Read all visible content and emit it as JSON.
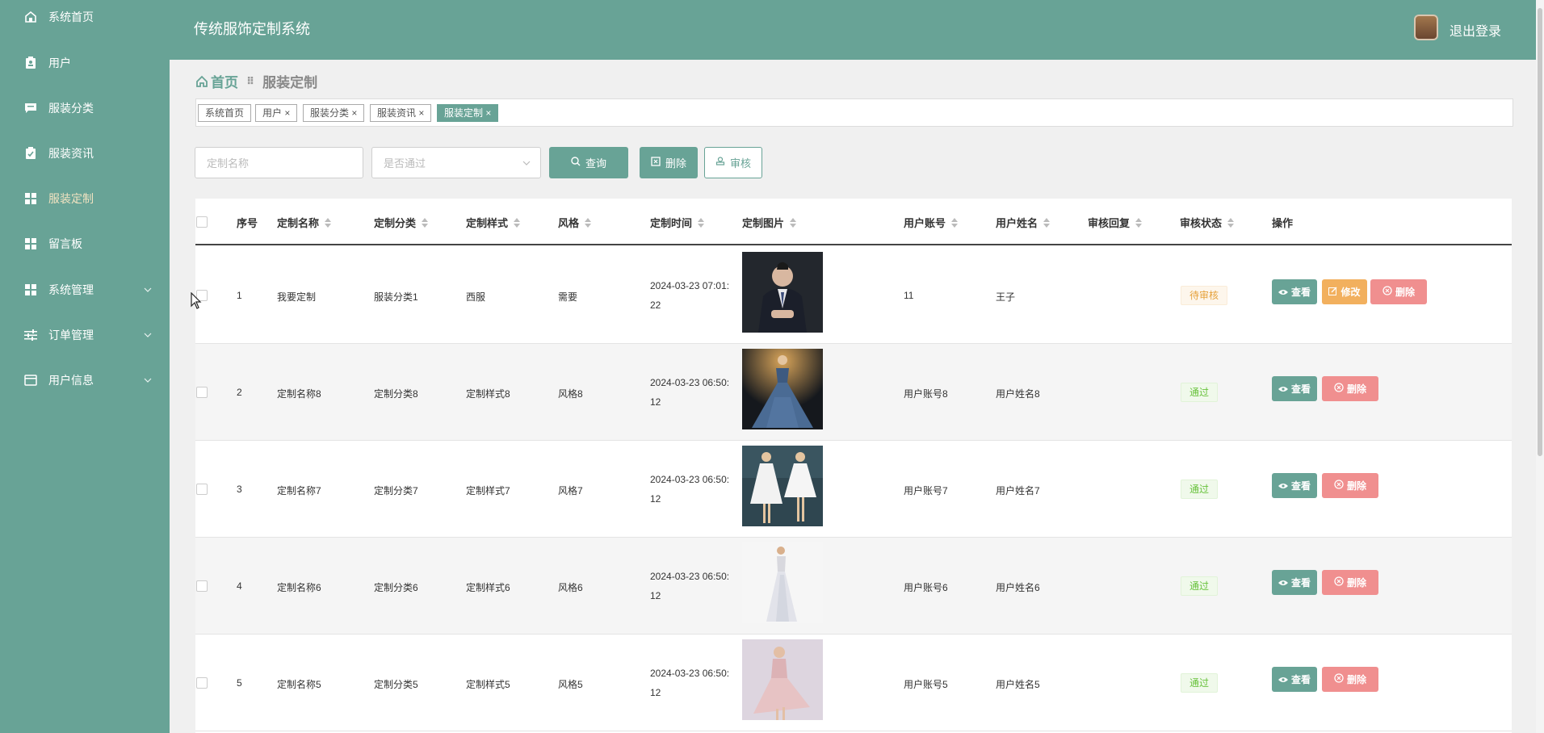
{
  "sidebar": {
    "items": [
      {
        "label": "系统首页",
        "icon": "home-icon"
      },
      {
        "label": "用户",
        "icon": "user-clipboard-icon"
      },
      {
        "label": "服装分类",
        "icon": "chat-icon"
      },
      {
        "label": "服装资讯",
        "icon": "clipboard-check-icon"
      },
      {
        "label": "服装定制",
        "icon": "grid-icon",
        "active": true
      },
      {
        "label": "留言板",
        "icon": "grid-icon"
      },
      {
        "label": "系统管理",
        "icon": "grid-icon",
        "expandable": true
      },
      {
        "label": "订单管理",
        "icon": "sliders-icon",
        "expandable": true
      },
      {
        "label": "用户信息",
        "icon": "card-icon",
        "expandable": true
      }
    ]
  },
  "header": {
    "title": "传统服饰定制系统",
    "logout": "退出登录"
  },
  "breadcrumb": {
    "home": "首页",
    "separator": "⠿",
    "current": "服装定制"
  },
  "tags": [
    {
      "label": "系统首页"
    },
    {
      "label": "用户 ×"
    },
    {
      "label": "服装分类 ×"
    },
    {
      "label": "服装资讯 ×"
    },
    {
      "label": "服装定制 ×",
      "active": true
    }
  ],
  "filters": {
    "name_placeholder": "定制名称",
    "approved_placeholder": "是否通过",
    "query_btn": "查询",
    "delete_btn": "删除",
    "review_btn": "审核"
  },
  "table": {
    "columns": [
      "序号",
      "定制名称",
      "定制分类",
      "定制样式",
      "风格",
      "定制时间",
      "定制图片",
      "用户账号",
      "用户姓名",
      "审核回复",
      "审核状态",
      "操作"
    ],
    "rows": [
      {
        "index": "1",
        "name": "我要定制",
        "category": "服装分类1",
        "style": "西服",
        "fashion": "需要",
        "time1": "2024-03-23 07:01:",
        "time2": "22",
        "account": "11",
        "username": "王子",
        "reply": "",
        "status": "待审核",
        "status_type": "pending",
        "actions": [
          "查看",
          "修改",
          "删除"
        ]
      },
      {
        "index": "2",
        "name": "定制名称8",
        "category": "定制分类8",
        "style": "定制样式8",
        "fashion": "风格8",
        "time1": "2024-03-23 06:50:",
        "time2": "12",
        "account": "用户账号8",
        "username": "用户姓名8",
        "reply": "",
        "status": "通过",
        "status_type": "pass",
        "actions": [
          "查看",
          "删除"
        ]
      },
      {
        "index": "3",
        "name": "定制名称7",
        "category": "定制分类7",
        "style": "定制样式7",
        "fashion": "风格7",
        "time1": "2024-03-23 06:50:",
        "time2": "12",
        "account": "用户账号7",
        "username": "用户姓名7",
        "reply": "",
        "status": "通过",
        "status_type": "pass",
        "actions": [
          "查看",
          "删除"
        ]
      },
      {
        "index": "4",
        "name": "定制名称6",
        "category": "定制分类6",
        "style": "定制样式6",
        "fashion": "风格6",
        "time1": "2024-03-23 06:50:",
        "time2": "12",
        "account": "用户账号6",
        "username": "用户姓名6",
        "reply": "",
        "status": "通过",
        "status_type": "pass",
        "actions": [
          "查看",
          "删除"
        ]
      },
      {
        "index": "5",
        "name": "定制名称5",
        "category": "定制分类5",
        "style": "定制样式5",
        "fashion": "风格5",
        "time1": "2024-03-23 06:50:",
        "time2": "12",
        "account": "用户账号5",
        "username": "用户姓名5",
        "reply": "",
        "status": "通过",
        "status_type": "pass",
        "actions": [
          "查看",
          "删除"
        ]
      }
    ]
  },
  "colors": {
    "accent": "#68a396",
    "warning": "#f2b05e",
    "danger": "#f08f8f"
  }
}
